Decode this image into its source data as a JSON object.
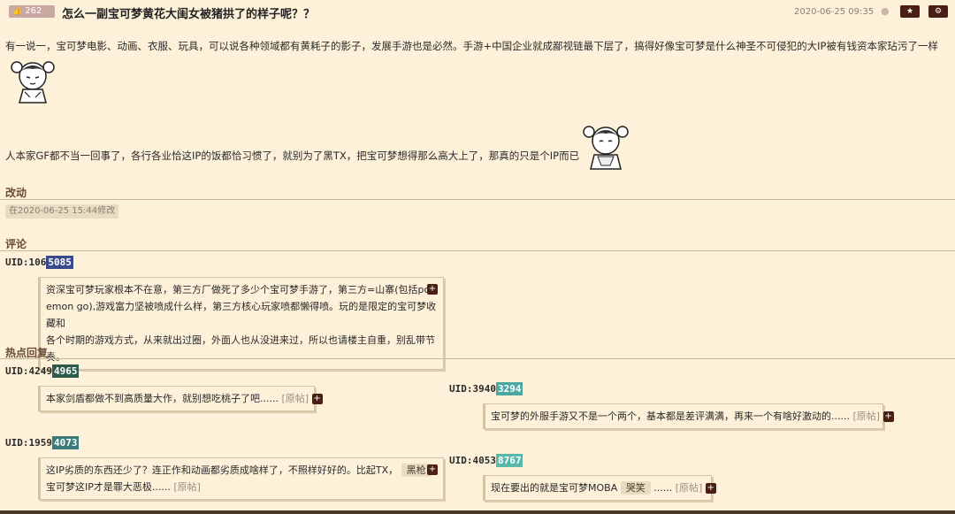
{
  "header": {
    "likes": "262",
    "title": "怎么一副宝可梦黄花大闺女被猪拱了的样子呢？？",
    "date": "2020-06-25 09:35",
    "star_label": "★",
    "gear_label": "⚙"
  },
  "post": {
    "para1": "有一说一，宝可梦电影、动画、衣服、玩具，可以说各种领域都有黄耗子的影子，发展手游也是必然。手游+中国企业就成鄙视链最下层了，搞得好像宝可梦是什么神圣不可侵犯的大IP被有钱资本家玷污了一样",
    "para2": "人本家GF都不当一回事了，各行各业恰这IP的饭都恰习惯了，就别为了黑TX，把宝可梦想得那么高大上了，那真的只是个IP而已"
  },
  "edit": {
    "section": "改动",
    "note": "在2020-06-25 15:44修改"
  },
  "comments": {
    "section": "评论",
    "main": {
      "uid_prefix": "UID:106",
      "uid_hl": "5085",
      "uid_color": "#3a4a8a",
      "line1": "资深宝可梦玩家根本不在意，第三方厂做死了多少个宝可梦手游了，第三方=山寨(包括pok",
      "line2": "emon go),游戏富力坚被喷成什么样，第三方核心玩家喷都懒得喷。玩的是限定的宝可梦收藏和",
      "line3": "各个时期的游戏方式，从来就出过圈，外面人也从没进来过，所以也请楼主自重，别乱带节奏。"
    }
  },
  "hot": {
    "section": "热点回复",
    "r1": {
      "uid_prefix": "UID:4249",
      "uid_hl": "4965",
      "uid_color": "#2d5a4a",
      "text": "本家剑盾都做不到高质量大作，就别想吃桃子了吧......",
      "src": "[原帖]"
    },
    "r2": {
      "uid_prefix": "UID:3940",
      "uid_hl": "3294",
      "uid_color": "#4aa8a0",
      "text": "宝可梦的外服手游又不是一个两个，基本都是差评满满，再来一个有啥好激动的......",
      "src": "[原帖]"
    },
    "r3": {
      "uid_prefix": "UID:1959",
      "uid_hl": "4073",
      "uid_color": "#3a7a7a",
      "line1": "这IP劣质的东西还少了？连正作和动画都劣质成啥样了，不照样好好的。比起TX，",
      "tag": "黑枪",
      "line2": "宝可梦这IP才是罪大恶极......",
      "src": "[原帖]"
    },
    "r4": {
      "uid_prefix": "UID:4053",
      "uid_hl": "8767",
      "uid_color": "#5ab8a8",
      "text": "现在要出的就是宝可梦MOBA",
      "tag": "哭笑",
      "after": "......",
      "src": "[原帖]"
    },
    "plus": "+"
  }
}
